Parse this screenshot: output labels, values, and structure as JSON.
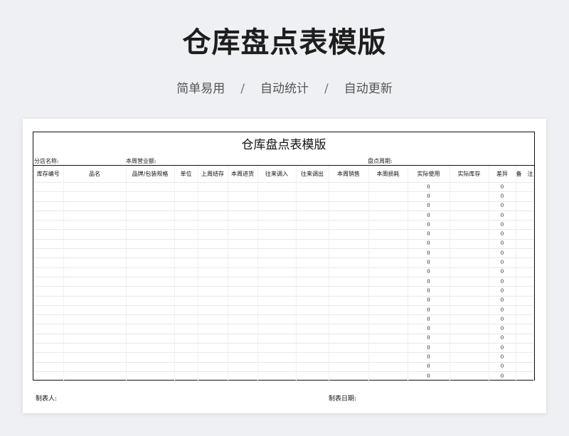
{
  "page": {
    "title": "仓库盘点表模版",
    "features": [
      "简单易用",
      "自动统计",
      "自动更新"
    ],
    "separator": "/"
  },
  "sheet": {
    "title": "仓库盘点表模版",
    "meta": {
      "store_label": "分店名称:",
      "sales_label": "本周营业额:",
      "period_label": "盘点周期:"
    },
    "columns": [
      "库存编号",
      "品名",
      "品牌/包装规格",
      "单位",
      "上周结存",
      "本周进货",
      "往来调入",
      "往来调出",
      "本周销售",
      "本周损耗",
      "实际使用",
      "实际库存",
      "差异",
      "备　注"
    ],
    "rows": [
      {
        "actual_use": "0",
        "difference": "0"
      },
      {
        "actual_use": "0",
        "difference": "0"
      },
      {
        "actual_use": "0",
        "difference": "0"
      },
      {
        "actual_use": "0",
        "difference": "0"
      },
      {
        "actual_use": "0",
        "difference": "0"
      },
      {
        "actual_use": "0",
        "difference": "0"
      },
      {
        "actual_use": "0",
        "difference": "0"
      },
      {
        "actual_use": "0",
        "difference": "0"
      },
      {
        "actual_use": "0",
        "difference": "0"
      },
      {
        "actual_use": "0",
        "difference": "0"
      },
      {
        "actual_use": "0",
        "difference": "0"
      },
      {
        "actual_use": "0",
        "difference": "0"
      },
      {
        "actual_use": "0",
        "difference": "0"
      },
      {
        "actual_use": "0",
        "difference": "0"
      },
      {
        "actual_use": "0",
        "difference": "0"
      },
      {
        "actual_use": "0",
        "difference": "0"
      },
      {
        "actual_use": "0",
        "difference": "0"
      },
      {
        "actual_use": "0",
        "difference": "0"
      },
      {
        "actual_use": "0",
        "difference": "0"
      },
      {
        "actual_use": "0",
        "difference": "0"
      },
      {
        "actual_use": "0",
        "difference": "0"
      }
    ],
    "footer": {
      "maker_label": "制表人:",
      "date_label": "制表日期:"
    }
  }
}
